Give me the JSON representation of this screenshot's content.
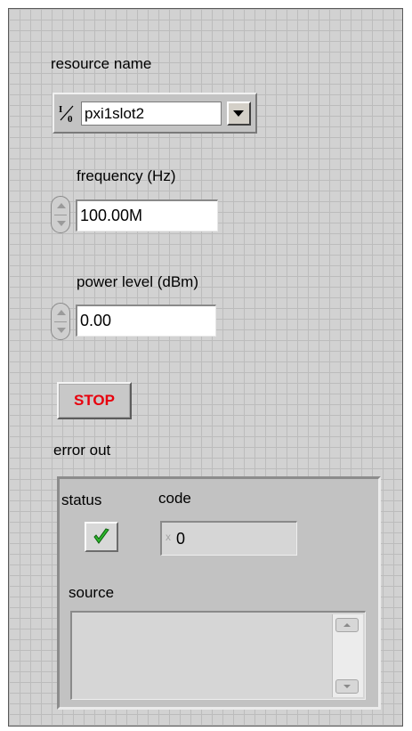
{
  "resource": {
    "label": "resource name",
    "value": "pxi1slot2",
    "icon": "io-icon"
  },
  "frequency": {
    "label": "frequency (Hz)",
    "value": "100.00M"
  },
  "power": {
    "label": "power level (dBm)",
    "value": "0.00"
  },
  "stop": {
    "label": "STOP",
    "color": "#e8000d"
  },
  "error_out": {
    "label": "error out",
    "status_label": "status",
    "status_value": "OK",
    "status_icon": "checkmark-icon",
    "code_label": "code",
    "code_value": "0",
    "code_radix": "x",
    "source_label": "source",
    "source_value": ""
  },
  "colors": {
    "panel_bg": "#d2d2d2",
    "grid": "#bcbcbc",
    "check_green": "#2db82d"
  }
}
